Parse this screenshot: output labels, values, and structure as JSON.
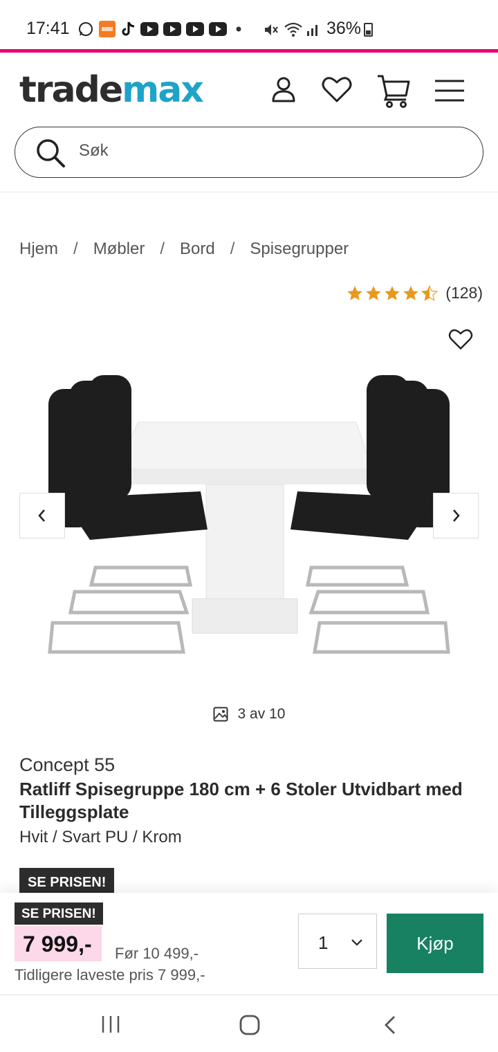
{
  "status_bar": {
    "time": "17:41",
    "battery": "36%",
    "icons": [
      "whatsapp-icon",
      "temu-icon",
      "tiktok-icon",
      "youtube-icon",
      "youtube-icon",
      "youtube-icon",
      "youtube-icon",
      "dot-icon",
      "mute-icon",
      "wifi-icon",
      "signal-icon",
      "battery-icon"
    ]
  },
  "header": {
    "logo_part1": "trade",
    "logo_part2": "max",
    "brand_colors": {
      "dark": "#2d2d2d",
      "blue": "#1fa3c9",
      "pink": "#e6006e"
    },
    "icons": [
      "account-icon",
      "heart-icon",
      "cart-icon",
      "menu-icon"
    ]
  },
  "search": {
    "placeholder": "Søk"
  },
  "breadcrumb": [
    "Hjem",
    "Møbler",
    "Bord",
    "Spisegrupper"
  ],
  "rating": {
    "stars": 4.5,
    "max": 5,
    "count_label": "(128)"
  },
  "gallery": {
    "counter": "3 av 10"
  },
  "product": {
    "brand": "Concept 55",
    "name": "Ratliff Spisegruppe 180 cm + 6 Stoler Utvidbart med Tilleggsplate",
    "variant": "Hvit / Svart PU / Krom",
    "badge": "SE PRISEN!"
  },
  "buy_bar": {
    "badge": "SE PRISEN!",
    "price": "7 999,-",
    "before_price": "Før 10 499,-",
    "lowest_price": "Tidligere laveste pris 7 999,-",
    "quantity": "1",
    "buy_label": "Kjøp",
    "price_highlight_color": "#fcd8e8",
    "buy_button_color": "#178162"
  }
}
